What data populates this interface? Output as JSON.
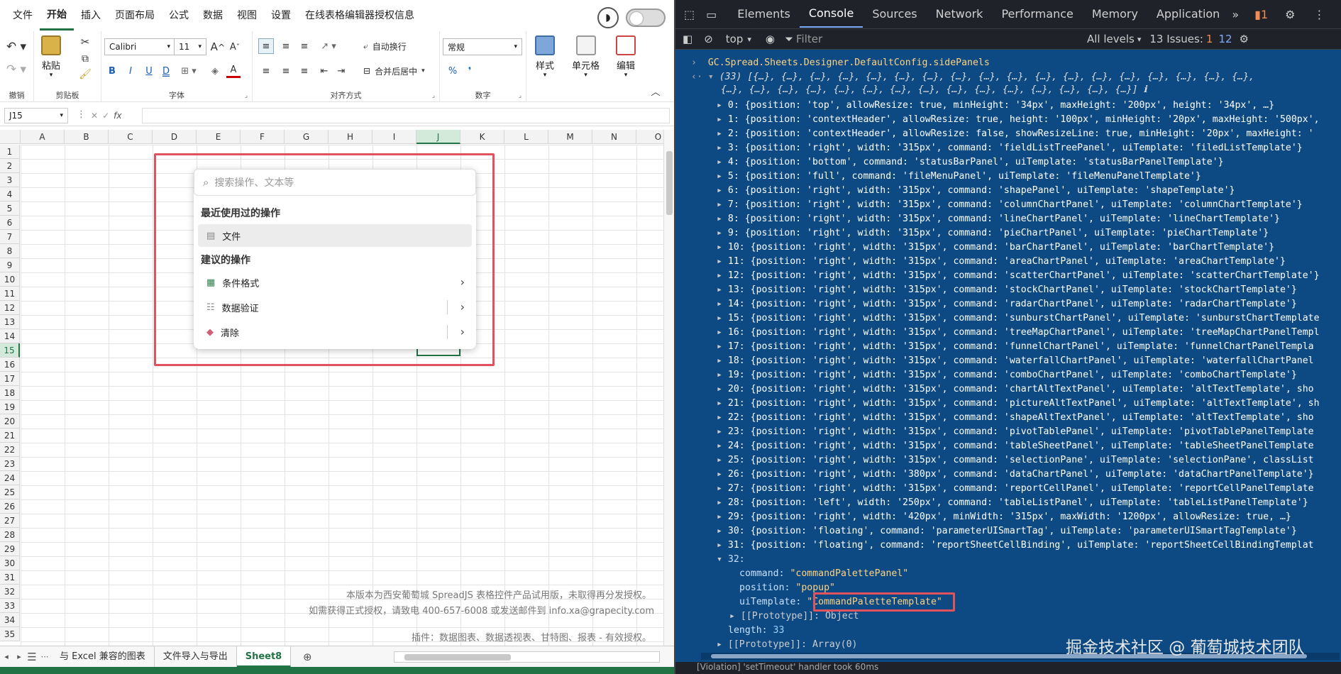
{
  "excel": {
    "menu": [
      "文件",
      "开始",
      "插入",
      "页面布局",
      "公式",
      "数据",
      "视图",
      "设置",
      "在线表格编辑器授权信息"
    ],
    "ribbon": {
      "undo_label": "撤销",
      "paste_label": "粘贴",
      "clipboard_label": "剪贴板",
      "font_name": "Calibri",
      "font_size": "11",
      "font_label": "字体",
      "wrap_label": "自动换行",
      "merge_label": "合并后居中",
      "align_label": "对齐方式",
      "numfmt": "常规",
      "number_label": "数字",
      "style_label": "样式",
      "cell_label": "单元格",
      "edit_label": "编辑"
    },
    "namebox": "J15",
    "fx": "fx",
    "columns": [
      "A",
      "B",
      "C",
      "D",
      "E",
      "F",
      "G",
      "H",
      "I",
      "J",
      "K",
      "L",
      "M",
      "N",
      "O"
    ],
    "rows": [
      "1",
      "2",
      "3",
      "4",
      "5",
      "6",
      "7",
      "8",
      "9",
      "10",
      "11",
      "12",
      "13",
      "14",
      "15",
      "16",
      "17",
      "18",
      "19",
      "20",
      "21",
      "22",
      "23",
      "24",
      "25",
      "26",
      "27",
      "28",
      "29",
      "30",
      "31",
      "32",
      "33",
      "34",
      "35"
    ],
    "active_col": "J",
    "active_row": "15",
    "palette": {
      "placeholder": "搜索操作、文本等",
      "recent_head": "最近使用过的操作",
      "recent_item": "文件",
      "suggest_head": "建议的操作",
      "items": [
        "条件格式",
        "数据验证",
        "清除"
      ]
    },
    "watermark": {
      "line1": "本版本为西安葡萄城 SpreadJS 表格控件产品试用版，未取得再分发授权。",
      "line2": "如需获得正式授权，请致电 400-657-6008 或发送邮件到 info.xa@grapecity.com",
      "line3": "插件：数据图表、数据透视表、甘特图、报表 - 有效授权。"
    },
    "sheets": [
      "与 Excel 兼容的图表",
      "文件导入与导出",
      "Sheet8"
    ]
  },
  "devtools": {
    "tabs": [
      "Elements",
      "Console",
      "Sources",
      "Network",
      "Performance",
      "Memory",
      "Application"
    ],
    "issues_badge": "1",
    "context": "top",
    "filter": "Filter",
    "levels": "All levels",
    "issues_label": "13 Issues:",
    "issues_err": "1",
    "issues_info": "12",
    "expression": "GC.Spread.Sheets.Designer.DefaultConfig.sidePanels",
    "summary_line": "(33) [{…}, {…}, {…}, {…}, {…}, {…}, {…}, {…}, {…}, {…}, {…}, {…}, {…}, {…}, {…}, {…}, {…}, {…},",
    "summary_line2": "{…}, {…}, {…}, {…}, {…}, {…}, {…}, {…}, {…}, {…}, {…}, {…}, {…}, {…}, {…}] ℹ",
    "entries": [
      "0: {position: 'top', allowResize: true, minHeight: '34px', maxHeight: '200px', height: '34px', …}",
      "1: {position: 'contextHeader', allowResize: true, height: '100px', minHeight: '20px', maxHeight: '500px',",
      "2: {position: 'contextHeader', allowResize: false, showResizeLine: true, minHeight: '20px', maxHeight: '",
      "3: {position: 'right', width: '315px', command: 'fieldListTreePanel', uiTemplate: 'filedListTemplate'}",
      "4: {position: 'bottom', command: 'statusBarPanel', uiTemplate: 'statusBarPanelTemplate'}",
      "5: {position: 'full', command: 'fileMenuPanel', uiTemplate: 'fileMenuPanelTemplate'}",
      "6: {position: 'right', width: '315px', command: 'shapePanel', uiTemplate: 'shapeTemplate'}",
      "7: {position: 'right', width: '315px', command: 'columnChartPanel', uiTemplate: 'columnChartTemplate'}",
      "8: {position: 'right', width: '315px', command: 'lineChartPanel', uiTemplate: 'lineChartTemplate'}",
      "9: {position: 'right', width: '315px', command: 'pieChartPanel', uiTemplate: 'pieChartTemplate'}",
      "10: {position: 'right', width: '315px', command: 'barChartPanel', uiTemplate: 'barChartTemplate'}",
      "11: {position: 'right', width: '315px', command: 'areaChartPanel', uiTemplate: 'areaChartTemplate'}",
      "12: {position: 'right', width: '315px', command: 'scatterChartPanel', uiTemplate: 'scatterChartTemplate'}",
      "13: {position: 'right', width: '315px', command: 'stockChartPanel', uiTemplate: 'stockChartTemplate'}",
      "14: {position: 'right', width: '315px', command: 'radarChartPanel', uiTemplate: 'radarChartTemplate'}",
      "15: {position: 'right', width: '315px', command: 'sunburstChartPanel', uiTemplate: 'sunburstChartTemplate",
      "16: {position: 'right', width: '315px', command: 'treeMapChartPanel', uiTemplate: 'treeMapChartPanelTempl",
      "17: {position: 'right', width: '315px', command: 'funnelChartPanel', uiTemplate: 'funnelChartPanelTempla",
      "18: {position: 'right', width: '315px', command: 'waterfallChartPanel', uiTemplate: 'waterfallChartPanel",
      "19: {position: 'right', width: '315px', command: 'comboChartPanel', uiTemplate: 'comboChartTemplate'}",
      "20: {position: 'right', width: '315px', command: 'chartAltTextPanel', uiTemplate: 'altTextTemplate', sho",
      "21: {position: 'right', width: '315px', command: 'pictureAltTextPanel', uiTemplate: 'altTextTemplate', sh",
      "22: {position: 'right', width: '315px', command: 'shapeAltTextPanel', uiTemplate: 'altTextTemplate', sho",
      "23: {position: 'right', width: '315px', command: 'pivotTablePanel', uiTemplate: 'pivotTablePanelTemplate",
      "24: {position: 'right', width: '315px', command: 'tableSheetPanel', uiTemplate: 'tableSheetPanelTemplate",
      "25: {position: 'right', width: '315px', command: 'selectionPane', uiTemplate: 'selectionPane', classList",
      "26: {position: 'right', width: '380px', command: 'dataChartPanel', uiTemplate: 'dataChartPanelTemplate'}",
      "27: {position: 'right', width: '315px', command: 'reportCellPanel', uiTemplate: 'reportCellPanelTemplate",
      "28: {position: 'left', width: '250px', command: 'tableListPanel', uiTemplate: 'tableListPanelTemplate'}",
      "29: {position: 'right', width: '420px', minWidth: '315px', maxWidth: '1200px', allowResize: true, …}",
      "30: {position: 'floating', command: 'parameterUISmartTag', uiTemplate: 'parameterUISmartTagTemplate'}",
      "31: {position: 'floating', command: 'reportSheetCellBinding', uiTemplate: 'reportSheetCellBindingTemplat"
    ],
    "entry32": "32:",
    "cmd_key": "command:",
    "cmd_val": "\"commandPalettePanel\"",
    "pos_key": "position:",
    "pos_val": "\"popup\"",
    "tpl_key": "uiTemplate:",
    "tpl_val": "\"CommandPaletteTemplate\"",
    "proto_obj": "[[Prototype]]: Object",
    "length_key": "length:",
    "length_val": "33",
    "proto_arr": "[[Prototype]]: Array(0)",
    "bottom_text": "[Violation] 'setTimeout' handler took 60ms"
  },
  "credit": "掘金技术社区 @ 葡萄城技术团队"
}
